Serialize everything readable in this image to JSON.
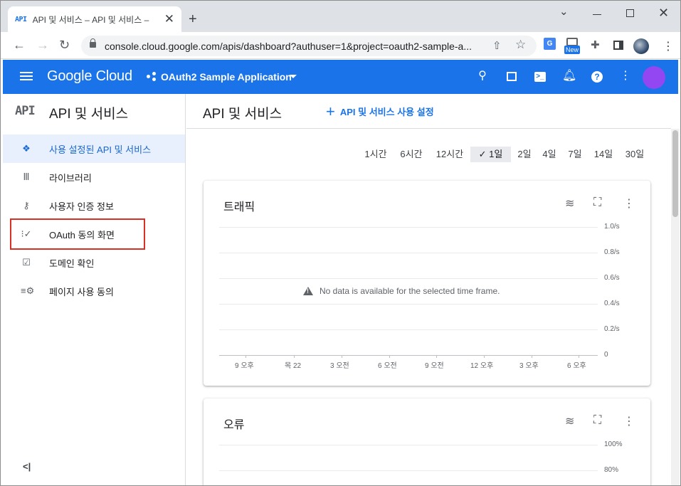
{
  "browser": {
    "tab_title": "API 및 서비스 – API 및 서비스 –",
    "tab_favicon": "API",
    "url": "console.cloud.google.com/apis/dashboard?authuser=1&project=oauth2-sample-a...",
    "extensions": {
      "new_badge": "New",
      "translate_label": "G"
    }
  },
  "header": {
    "logo_text": "Google Cloud",
    "project_name": "OAuth2 Sample Application",
    "icons": [
      "search-icon",
      "gift-icon",
      "terminal-icon",
      "notifications-icon",
      "help-icon",
      "more-vert-icon"
    ],
    "avatar_color": "#a142f4"
  },
  "sidebar": {
    "product_icon": "API",
    "title": "API 및 서비스",
    "items": [
      {
        "label": "사용 설정된 API 및 서비스",
        "icon": "api-diamond-icon",
        "active": true
      },
      {
        "label": "라이브러리",
        "icon": "library-icon",
        "active": false
      },
      {
        "label": "사용자 인증 정보",
        "icon": "key-icon",
        "active": false
      },
      {
        "label": "OAuth 동의 화면",
        "icon": "consent-icon",
        "active": false
      },
      {
        "label": "도메인 확인",
        "icon": "checkbox-icon",
        "active": false
      },
      {
        "label": "페이지 사용 동의",
        "icon": "settings-list-icon",
        "active": false
      }
    ],
    "collapse_label": "<|"
  },
  "main": {
    "title": "API 및 서비스",
    "enable_button": "API 및 서비스 사용 설정",
    "time_ranges": [
      "1시간",
      "6시간",
      "12시간",
      "1일",
      "2일",
      "4일",
      "7일",
      "14일",
      "30일"
    ],
    "selected_range": "1일",
    "accent_color": "#1a73e8"
  },
  "traffic_card": {
    "title": "트래픽",
    "no_data": "No data is available for the selected time frame.",
    "y_ticks": [
      "1.0/s",
      "0.8/s",
      "0.6/s",
      "0.4/s",
      "0.2/s",
      "0"
    ],
    "x_ticks": [
      "9 오후",
      "목 22",
      "3 오전",
      "6 오전",
      "9 오전",
      "12 오후",
      "3 오후",
      "6 오후"
    ]
  },
  "errors_card": {
    "title": "오류",
    "y_ticks": [
      "100%",
      "80%"
    ]
  }
}
